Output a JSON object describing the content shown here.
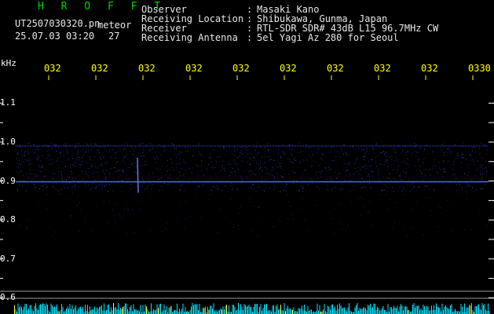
{
  "app": {
    "title": "H R O F F T",
    "filename": "UT2507030320.pn",
    "tag": "meteor",
    "datetime": "25.07.03 03:20",
    "count": "27"
  },
  "info": [
    {
      "label": "Observer",
      "sep": ":",
      "value": "Masaki Kano"
    },
    {
      "label": "Receiving Location",
      "sep": ":",
      "value": "Shibukawa, Gunma, Japan"
    },
    {
      "label": "Receiver",
      "sep": ":",
      "value": "RTL-SDR SDR# 43dB L15 96.7MHz CW"
    },
    {
      "label": "Receiving Antenna",
      "sep": ":",
      "value": "5el Yagi Az 280 for Seoul"
    }
  ],
  "axis": {
    "y_unit": "kHz",
    "y_ticks": [
      "1.1",
      "1.0",
      "0.9",
      "0.8",
      "0.7",
      "0.6"
    ],
    "x_ticks": [
      "032",
      "032",
      "032",
      "032",
      "032",
      "032",
      "032",
      "032",
      "032",
      "0330"
    ]
  },
  "colors": {
    "background": "#000000",
    "title": "#00d000",
    "info_text": "#e8e8e8",
    "time_labels": "#ffff00",
    "signal": "#3b4dff",
    "bottom_bars": "#00e5ff"
  },
  "chart_data": {
    "type": "heatmap",
    "y_unit": "kHz",
    "ylim": [
      0.6,
      1.15
    ],
    "signal_band": [
      0.89,
      0.99
    ],
    "carrier_khz": 0.9,
    "band_edge_khz": 0.99,
    "meteor_echo_khz": [
      0.87,
      0.96
    ]
  }
}
